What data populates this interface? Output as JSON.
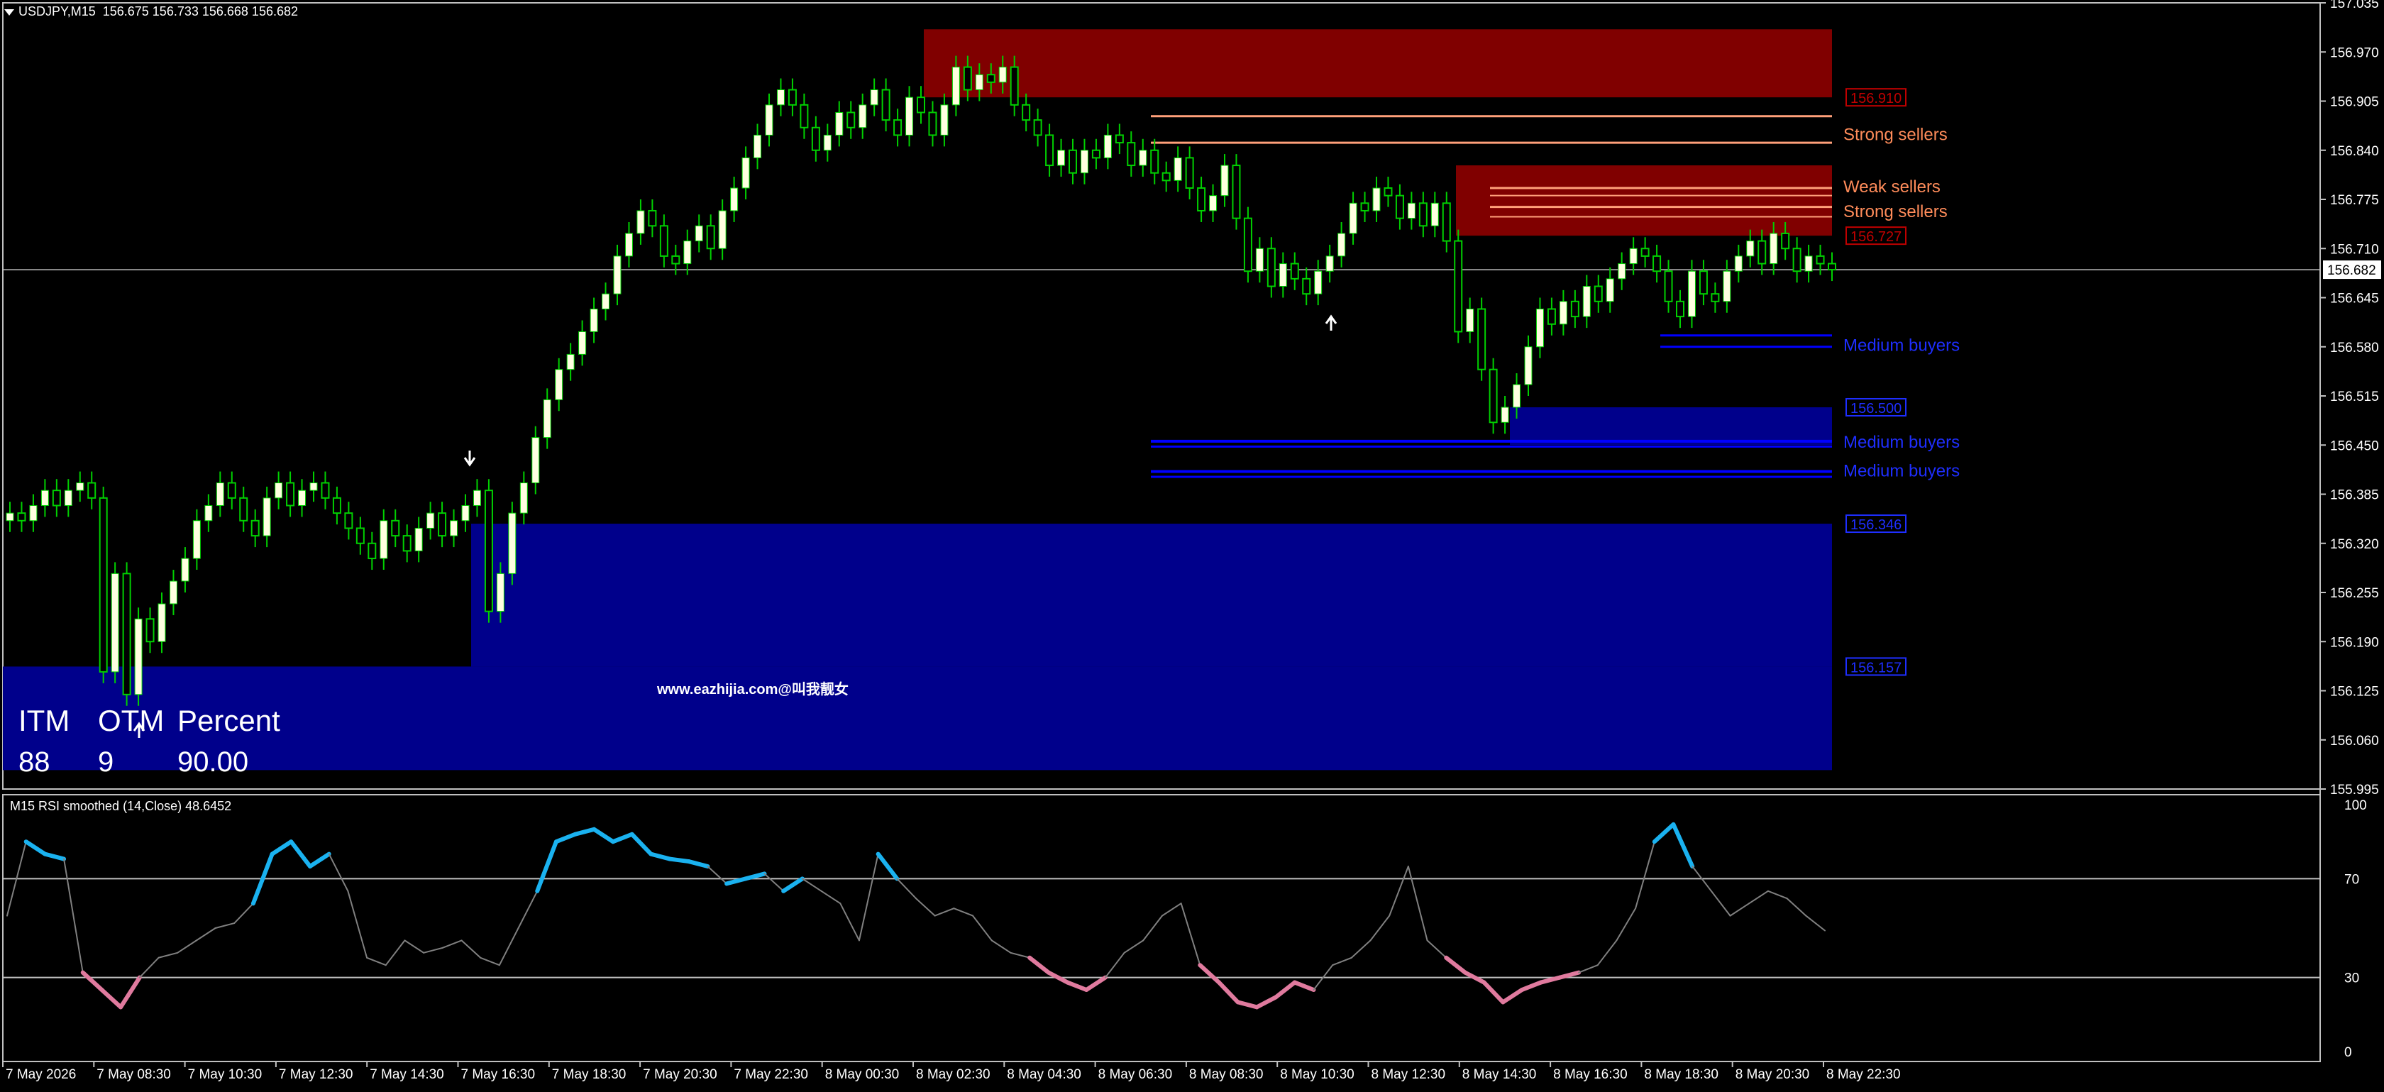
{
  "header": {
    "symbol_timeframe": "USDJPY,M15",
    "ohlc": "156.675 156.733 156.668 156.682"
  },
  "rsi_panel": {
    "title": "M15 RSI smoothed (14,Close) 48.6452",
    "levels": [
      "100",
      "70",
      "30",
      "0"
    ]
  },
  "stats": {
    "itm_label": "ITM",
    "otm_label": "OTM",
    "percent_label": "Percent",
    "itm_value": "88",
    "otm_value": "9",
    "percent_value": "90.00"
  },
  "watermark": "www.eazhijia.com@叫我靓女",
  "zones": {
    "sell_zone_top_label": "156.910",
    "sell_zone_mid_label": "156.727",
    "buy_zone_mid_label": "156.500",
    "buy_zone_low_top_label": "156.346",
    "buy_zone_low_bot_label": "156.157"
  },
  "level_labels": {
    "strong_sellers_1": "Strong sellers",
    "weak_sellers": "Weak sellers",
    "strong_sellers_2": "Strong sellers",
    "medium_buyers_1": "Medium buyers",
    "medium_buyers_2": "Medium buyers",
    "medium_buyers_3": "Medium buyers"
  },
  "price_axis": {
    "ticks": [
      "157.035",
      "156.970",
      "156.905",
      "156.840",
      "156.775",
      "156.710",
      "156.645",
      "156.580",
      "156.515",
      "156.450",
      "156.385",
      "156.320",
      "156.255",
      "156.190",
      "156.125",
      "156.060",
      "155.995"
    ],
    "current_price": "156.682"
  },
  "time_axis": {
    "ticks": [
      "7 May 2026",
      "7 May 08:30",
      "7 May 10:30",
      "7 May 12:30",
      "7 May 14:30",
      "7 May 16:30",
      "7 May 18:30",
      "7 May 20:30",
      "7 May 22:30",
      "8 May 00:30",
      "8 May 02:30",
      "8 May 04:30",
      "8 May 06:30",
      "8 May 08:30",
      "8 May 10:30",
      "8 May 12:30",
      "8 May 14:30",
      "8 May 16:30",
      "8 May 18:30",
      "8 May 20:30",
      "8 May 22:30"
    ]
  },
  "colors": {
    "background": "#000000",
    "bull_candle": "#ffffe0",
    "wick": "#00d000",
    "sell_zone": "#800000",
    "buy_zone": "#00008b",
    "seller_line": "#ffa07a",
    "buyer_line": "#0000ff",
    "rsi_up": "#1ab2f0",
    "rsi_down": "#e07a9e",
    "rsi_neutral": "#808080",
    "grid_line": "#c0c0c0"
  },
  "chart_data": {
    "type": "candlestick",
    "x": [
      "7 May 06:30",
      "7 May 06:45",
      "7 May 07:00",
      "7 May 07:15",
      "7 May 07:30",
      "7 May 07:45",
      "7 May 08:00",
      "7 May 08:15",
      "7 May 08:30",
      "7 May 08:45",
      "7 May 09:00",
      "7 May 09:15",
      "7 May 09:30",
      "7 May 09:45",
      "7 May 10:00",
      "7 May 10:15",
      "7 May 10:30",
      "7 May 10:45",
      "7 May 11:00",
      "7 May 11:15",
      "7 May 11:30",
      "7 May 11:45",
      "7 May 12:00",
      "7 May 12:15",
      "7 May 12:30",
      "7 May 12:45",
      "7 May 13:00",
      "7 May 13:15",
      "7 May 13:30",
      "7 May 13:45",
      "7 May 14:00",
      "7 May 14:15",
      "7 May 14:30",
      "7 May 14:45",
      "7 May 15:00",
      "7 May 15:15",
      "7 May 15:30",
      "7 May 15:45",
      "7 May 16:00",
      "7 May 16:15",
      "7 May 16:30",
      "7 May 16:45",
      "7 May 17:00",
      "7 May 17:15",
      "7 May 17:30",
      "7 May 17:45",
      "7 May 18:00",
      "7 May 18:15",
      "7 May 18:30",
      "7 May 18:45",
      "7 May 19:00",
      "7 May 19:15",
      "7 May 19:30",
      "7 May 19:45",
      "7 May 20:00",
      "7 May 20:15",
      "7 May 20:30",
      "7 May 20:45",
      "7 May 21:00",
      "7 May 21:15",
      "7 May 21:30",
      "7 May 21:45",
      "7 May 22:00",
      "7 May 22:15",
      "7 May 22:30",
      "7 May 22:45",
      "7 May 23:00",
      "7 May 23:15",
      "7 May 23:30",
      "7 May 23:45",
      "8 May 00:00",
      "8 May 00:15",
      "8 May 00:30",
      "8 May 00:45",
      "8 May 01:00",
      "8 May 01:15",
      "8 May 01:30",
      "8 May 01:45",
      "8 May 02:00",
      "8 May 02:15",
      "8 May 02:30",
      "8 May 02:45",
      "8 May 03:00",
      "8 May 03:15",
      "8 May 03:30",
      "8 May 03:45",
      "8 May 04:00",
      "8 May 04:15",
      "8 May 04:30",
      "8 May 04:45",
      "8 May 05:00",
      "8 May 05:15",
      "8 May 05:30",
      "8 May 05:45",
      "8 May 06:00",
      "8 May 06:15",
      "8 May 06:30",
      "8 May 06:45",
      "8 May 07:00",
      "8 May 07:15",
      "8 May 07:30",
      "8 May 07:45",
      "8 May 08:00",
      "8 May 08:15",
      "8 May 08:30",
      "8 May 08:45",
      "8 May 09:00",
      "8 May 09:15",
      "8 May 09:30",
      "8 May 09:45",
      "8 May 10:00",
      "8 May 10:15",
      "8 May 10:30",
      "8 May 10:45",
      "8 May 11:00",
      "8 May 11:15",
      "8 May 11:30",
      "8 May 11:45",
      "8 May 12:00",
      "8 May 12:15",
      "8 May 12:30",
      "8 May 12:45",
      "8 May 13:00",
      "8 May 13:15",
      "8 May 13:30",
      "8 May 13:45",
      "8 May 14:00",
      "8 May 14:15",
      "8 May 14:30",
      "8 May 14:45",
      "8 May 15:00",
      "8 May 15:15",
      "8 May 15:30",
      "8 May 15:45",
      "8 May 16:00",
      "8 May 16:15",
      "8 May 16:30",
      "8 May 16:45",
      "8 May 17:00",
      "8 May 17:15",
      "8 May 17:30",
      "8 May 17:45",
      "8 May 18:00",
      "8 May 18:15",
      "8 May 18:30",
      "8 May 18:45",
      "8 May 19:00",
      "8 May 19:15",
      "8 May 19:30",
      "8 May 19:45",
      "8 May 20:00",
      "8 May 20:15",
      "8 May 20:30",
      "8 May 20:45",
      "8 May 21:00",
      "8 May 21:15",
      "8 May 21:30",
      "8 May 21:45",
      "8 May 22:00",
      "8 May 22:15",
      "8 May 22:30",
      "8 May 22:45"
    ],
    "close": [
      156.36,
      156.35,
      156.37,
      156.39,
      156.37,
      156.39,
      156.4,
      156.38,
      156.15,
      156.28,
      156.12,
      156.22,
      156.19,
      156.24,
      156.27,
      156.3,
      156.35,
      156.37,
      156.4,
      156.38,
      156.35,
      156.33,
      156.38,
      156.4,
      156.37,
      156.39,
      156.4,
      156.38,
      156.36,
      156.34,
      156.32,
      156.3,
      156.35,
      156.33,
      156.31,
      156.34,
      156.36,
      156.33,
      156.35,
      156.37,
      156.39,
      156.23,
      156.28,
      156.36,
      156.4,
      156.46,
      156.51,
      156.55,
      156.57,
      156.6,
      156.63,
      156.65,
      156.7,
      156.73,
      156.76,
      156.74,
      156.7,
      156.69,
      156.72,
      156.74,
      156.71,
      156.76,
      156.79,
      156.83,
      156.86,
      156.9,
      156.92,
      156.9,
      156.87,
      156.84,
      156.86,
      156.89,
      156.87,
      156.9,
      156.92,
      156.88,
      156.86,
      156.91,
      156.89,
      156.86,
      156.9,
      156.95,
      156.92,
      156.94,
      156.93,
      156.95,
      156.9,
      156.88,
      156.86,
      156.82,
      156.84,
      156.81,
      156.84,
      156.83,
      156.86,
      156.85,
      156.82,
      156.84,
      156.81,
      156.8,
      156.83,
      156.79,
      156.76,
      156.78,
      156.82,
      156.75,
      156.68,
      156.71,
      156.66,
      156.69,
      156.67,
      156.65,
      156.68,
      156.7,
      156.73,
      156.77,
      156.76,
      156.79,
      156.78,
      156.75,
      156.77,
      156.74,
      156.77,
      156.72,
      156.6,
      156.63,
      156.55,
      156.48,
      156.5,
      156.53,
      156.58,
      156.63,
      156.61,
      156.64,
      156.62,
      156.66,
      156.64,
      156.67,
      156.69,
      156.71,
      156.7,
      156.68,
      156.64,
      156.62,
      156.68,
      156.65,
      156.64,
      156.68,
      156.7,
      156.72,
      156.69,
      156.73,
      156.71,
      156.68,
      156.7,
      156.69,
      156.682
    ],
    "levels": {
      "sell_zone_upper": [
        156.91,
        157.0
      ],
      "sell_zone_lower": [
        156.727,
        156.82
      ],
      "buy_zone_upper": [
        156.45,
        156.5
      ],
      "buy_zone_middle": [
        156.157,
        156.346
      ],
      "buy_zone_lower": [
        156.02,
        156.157
      ],
      "strong_sellers_1": 156.85,
      "weak_sellers": 156.79,
      "strong_sellers_2": 156.765,
      "medium_buyers_1": 156.595,
      "medium_buyers_2": 156.455,
      "medium_buyers_3": 156.415
    },
    "ylim": [
      155.995,
      157.035
    ],
    "rsi": [
      55,
      85,
      80,
      78,
      32,
      25,
      18,
      30,
      38,
      40,
      45,
      50,
      52,
      60,
      80,
      85,
      75,
      80,
      65,
      38,
      35,
      45,
      40,
      42,
      45,
      38,
      35,
      50,
      65,
      85,
      88,
      90,
      85,
      88,
      80,
      78,
      77,
      75,
      68,
      70,
      72,
      65,
      70,
      65,
      60,
      45,
      80,
      70,
      62,
      55,
      58,
      55,
      45,
      40,
      38,
      32,
      28,
      25,
      30,
      40,
      45,
      55,
      60,
      35,
      28,
      20,
      18,
      22,
      28,
      25,
      35,
      38,
      45,
      55,
      75,
      45,
      38,
      32,
      28,
      20,
      25,
      28,
      30,
      32,
      35,
      45,
      58,
      85,
      92,
      75,
      65,
      55,
      60,
      65,
      62,
      55,
      49
    ],
    "rsi_ylim": [
      0,
      100
    ]
  }
}
